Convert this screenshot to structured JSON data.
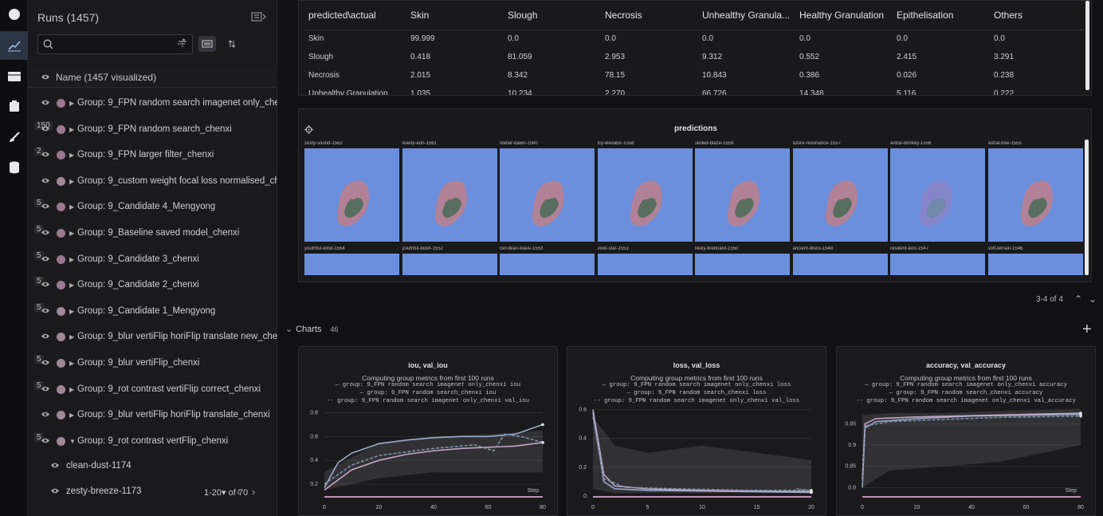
{
  "rail": {
    "items": [
      "home-icon",
      "charts-icon",
      "table-icon",
      "artifacts-icon",
      "sweep-icon",
      "database-icon"
    ]
  },
  "runs": {
    "title": "Runs (1457)",
    "search_placeholder": "",
    "regex_label": ".*",
    "name_header": "Name (1457 visualized)",
    "rows": [
      {
        "label": "Group: 9_FPN random search imagenet only_chenxi",
        "count": "",
        "dot": "#9b7890"
      },
      {
        "label": "Group: 9_FPN random search_chenxi",
        "count": "150",
        "dot": "#9b7890"
      },
      {
        "label": "Group: 9_FPN larger filter_chenxi",
        "count": "2",
        "dot": "#9b7890"
      },
      {
        "label": "Group: 9_custom weight focal loss normalised_chenxi",
        "count": "",
        "dot": "#a08898"
      },
      {
        "label": "Group: 9_Candidate 4_Mengyong",
        "count": "5",
        "dot": "#9b7890"
      },
      {
        "label": "Group: 9_Baseline saved model_chenxi",
        "count": "5",
        "dot": "#9b7890"
      },
      {
        "label": "Group: 9_Candidate 3_chenxi",
        "count": "5",
        "dot": "#9b7890"
      },
      {
        "label": "Group: 9_Candidate 2_chenxi",
        "count": "5",
        "dot": "#9b7890"
      },
      {
        "label": "Group: 9_Candidate 1_Mengyong",
        "count": "5",
        "dot": "#a08898"
      },
      {
        "label": "Group: 9_blur vertiFlip horiFlip translate new_chenxi",
        "count": "",
        "dot": "#a08898"
      },
      {
        "label": "Group: 9_blur vertiFlip_chenxi",
        "count": "5",
        "dot": "#a08898"
      },
      {
        "label": "Group: 9_rot contrast vertiFlip correct_chenxi",
        "count": "5",
        "dot": "#a08898"
      },
      {
        "label": "Group: 9_blur vertiFlip horiFlip translate_chenxi",
        "count": "",
        "dot": "#a08898"
      },
      {
        "label": "Group: 9_rot contrast vertFlip_chenxi",
        "count": "5",
        "dot": "#a08898"
      }
    ],
    "children": [
      "clean-dust-1174",
      "zesty-breeze-1173"
    ],
    "pager": "1-20▾ of 70"
  },
  "confusion": {
    "headers": [
      "predicted\\actual",
      "Skin",
      "Slough",
      "Necrosis",
      "Unhealthy Granula...",
      "Healthy Granulation",
      "Epithelisation",
      "Others"
    ],
    "rows": [
      [
        "Skin",
        "99.999",
        "0.0",
        "0.0",
        "0.0",
        "0.0",
        "0.0",
        "0.0"
      ],
      [
        "Slough",
        "0.418",
        "81.059",
        "2.953",
        "9.312",
        "0.552",
        "2.415",
        "3.291"
      ],
      [
        "Necrosis",
        "2.015",
        "8.342",
        "78.15",
        "10.843",
        "0.386",
        "0.026",
        "0.238"
      ],
      [
        "Unhealthy Granulation",
        "1.035",
        "10.234",
        "2.270",
        "66.726",
        "14.348",
        "5.116",
        "0.222"
      ]
    ]
  },
  "predictions": {
    "title": "predictions",
    "row1": [
      "zesty-sound-1562",
      "toasty-eon-1561",
      "stellar-dawn-1560",
      "icy-elevator-1558",
      "skilled-blaze-1559",
      "azure-resonance-1557",
      "astral-donkey-1556",
      "astral-tree-1555"
    ],
    "row2": [
      "youthful-wind-1554",
      "youthful-bush-1552",
      "cerulean-wave-1553",
      "vivid-star-1551",
      "likely-fireboard-1550",
      "ancient-disco-1548",
      "resilient-eon-1547",
      "soft-terrain-1546"
    ],
    "bg_color": "#6b8fdc"
  },
  "pagination": {
    "label": "3-4 of 4"
  },
  "charts_section": {
    "label": "Charts",
    "count": "46"
  },
  "charts": [
    {
      "title": "iou, val_iou",
      "subtitle": "Computing group metrics from first 100 runs",
      "legend": [
        "group: 9_FPN random search imagenet only_chenxi iou",
        "group: 9_FPN random search_chenxi iou",
        "group: 9_FPN random search imagenet only_chenxi val_iou"
      ],
      "yticks": [
        "0.2",
        "0.4",
        "0.6",
        "0.8"
      ],
      "xticks": [
        "0",
        "20",
        "40",
        "60",
        "80"
      ],
      "step_label": "Step"
    },
    {
      "title": "loss, val_loss",
      "subtitle": "Computing group metrics from first 100 runs",
      "legend": [
        "group: 9_FPN random search imagenet only_chenxi loss",
        "group: 9_FPN random search_chenxi loss",
        "group: 9_FPN random search imagenet only_chenxi val_loss"
      ],
      "yticks": [
        "0",
        "0.2",
        "0.4",
        "0.6"
      ],
      "xticks": [
        "0",
        "5",
        "10",
        "15",
        "20"
      ],
      "step_label": "Step"
    },
    {
      "title": "accuracy, val_accuracy",
      "subtitle": "Computing group metrics from first 100 runs",
      "legend": [
        "group: 9_FPN random search imagenet only_chenxi accuracy",
        "group: 9_FPN random search_chenxi accuracy",
        "group: 9_FPN random search imagenet only_chenxi val_accuracy"
      ],
      "yticks": [
        "0.8",
        "0.85",
        "0.9",
        "0.95"
      ],
      "xticks": [
        "0",
        "20",
        "40",
        "60",
        "80"
      ],
      "step_label": "Step"
    }
  ]
}
